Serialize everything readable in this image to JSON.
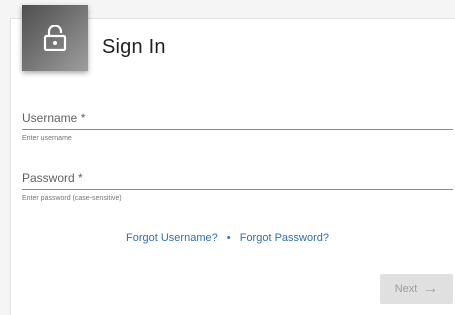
{
  "signin": {
    "title": "Sign In",
    "lock_icon": "lock-open-icon",
    "username": {
      "label": "Username *",
      "helper": "Enter username",
      "value": ""
    },
    "password": {
      "label": "Password *",
      "helper": "Enter password (case-sensitive)",
      "value": ""
    },
    "links": {
      "forgot_username": "Forgot Username?",
      "separator": "•",
      "forgot_password": "Forgot Password?"
    },
    "next_button": {
      "label": "Next",
      "arrow": "→",
      "enabled": false
    },
    "colors": {
      "link": "#2f6fb3",
      "button_bg_disabled": "#e0e0e0",
      "button_text_disabled": "#9e9e9e"
    }
  }
}
